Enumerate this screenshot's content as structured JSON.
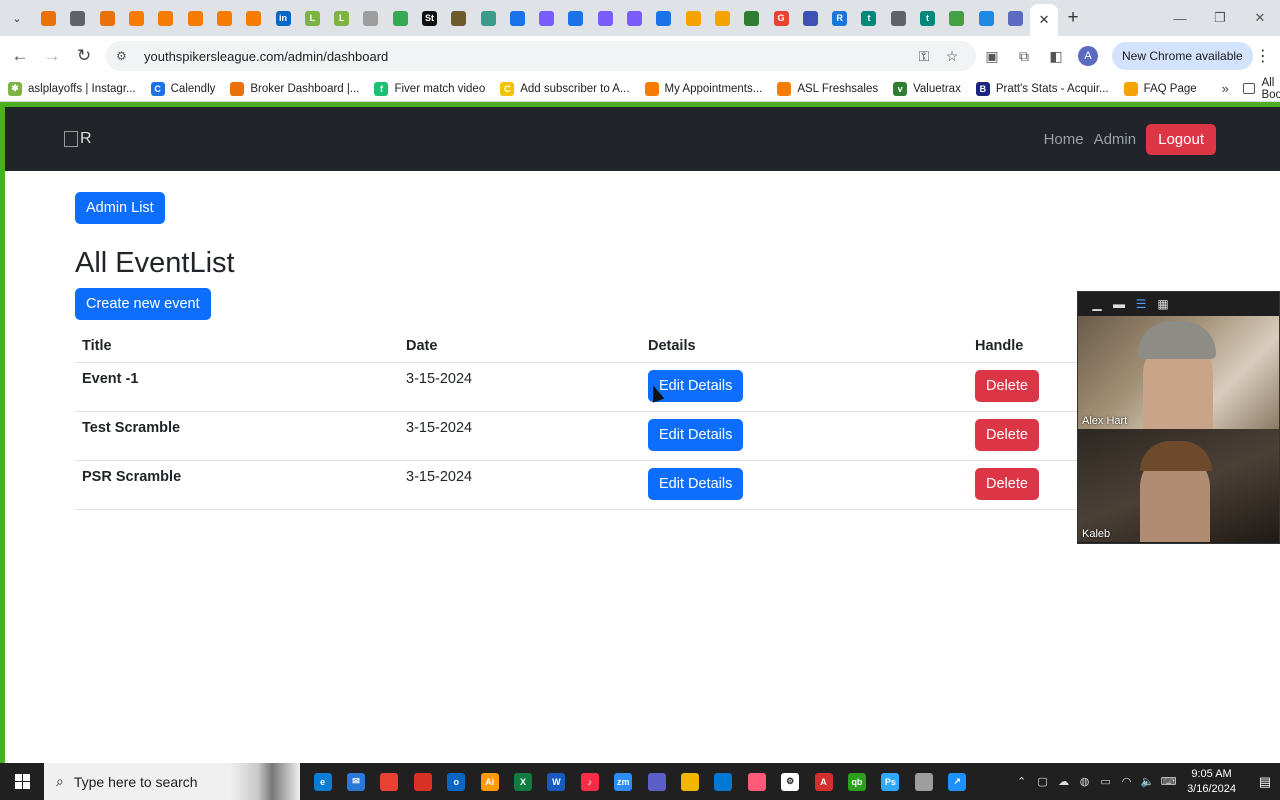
{
  "browser": {
    "tab_colors": [
      "#e8710a",
      "#5f6368",
      "#e8710a",
      "#f57c00",
      "#f57c00",
      "#f57c00",
      "#f57c00",
      "#f57c00",
      "#0a66c2",
      "#7cb342",
      "#7cb342",
      "#9e9e9e",
      "#34a853",
      "#111111",
      "#6d5b2e",
      "#3c9a8a",
      "#1a73e8",
      "#7b5cff",
      "#1a73e8",
      "#7b5cff",
      "#7b5cff",
      "#1a73e8",
      "#f4a300",
      "#f4a300",
      "#2e7d32",
      "#ea4335",
      "#3f51b5",
      "#1976d2",
      "#00897b",
      "#5f6368",
      "#00897b",
      "#43a047",
      "#1e88e5",
      "#5c6bc0"
    ],
    "tab_glyphs": [
      "",
      "",
      "",
      "",
      "",
      "",
      "",
      "",
      "in",
      "L",
      "L",
      "",
      "",
      "St",
      "",
      "",
      "",
      "",
      "",
      "",
      "",
      "",
      "",
      "",
      "",
      "G",
      "",
      "R",
      "t",
      "",
      "t",
      "",
      "",
      ""
    ],
    "url": "youthspikersleague.com/admin/dashboard",
    "update_label": "New Chrome available",
    "profile_initial": "A"
  },
  "bookmarks": [
    {
      "label": "aslplayoffs | Instagr...",
      "color": "#7cb342",
      "glyph": "✱"
    },
    {
      "label": "Calendly",
      "color": "#1a73e8",
      "glyph": "C"
    },
    {
      "label": "Broker Dashboard |...",
      "color": "#e8710a",
      "glyph": ""
    },
    {
      "label": "Fiver match video",
      "color": "#1dbf73",
      "glyph": "f"
    },
    {
      "label": "Add subscriber to A...",
      "color": "#f4c300",
      "glyph": "C"
    },
    {
      "label": "My Appointments...",
      "color": "#f57c00",
      "glyph": ""
    },
    {
      "label": "ASL Freshsales",
      "color": "#f57c00",
      "glyph": ""
    },
    {
      "label": "Valuetrax",
      "color": "#2e7d32",
      "glyph": "v"
    },
    {
      "label": "Pratt's Stats - Acquir...",
      "color": "#1a237e",
      "glyph": "B"
    },
    {
      "label": "FAQ Page",
      "color": "#f4a300",
      "glyph": ""
    }
  ],
  "bookmarks_all": "All Bookmarks",
  "site": {
    "logo_alt": "R",
    "nav": {
      "home": "Home",
      "admin": "Admin",
      "logout": "Logout"
    },
    "admin_list_btn": "Admin List",
    "heading": "All EventList",
    "create_btn": "Create new event",
    "columns": [
      "Title",
      "Date",
      "Details",
      "Handle"
    ],
    "events": [
      {
        "title": "Event -1",
        "date": "3-15-2024",
        "edit": "Edit Details",
        "delete": "Delete"
      },
      {
        "title": "Test Scramble",
        "date": "3-15-2024",
        "edit": "Edit Details",
        "delete": "Delete"
      },
      {
        "title": "PSR Scramble",
        "date": "3-15-2024",
        "edit": "Edit Details",
        "delete": "Delete"
      }
    ]
  },
  "call": {
    "participants": [
      "Alex Hart",
      "Kaleb"
    ]
  },
  "taskbar": {
    "search_placeholder": "Type here to search",
    "app_colors": [
      "#0a7cd4",
      "#2b78d9",
      "#e94235",
      "#d93025",
      "#0a66c2",
      "#ff9a00",
      "#107c41",
      "#185abd",
      "#fa2d48",
      "#2d8cff",
      "#5b5fc7",
      "#f2b600",
      "#0078d4",
      "#ff5a79",
      "#ffffff",
      "#d32f2f",
      "#2ca01c",
      "#31a8ff",
      "#9e9e9e",
      "#1e90ff"
    ],
    "app_glyphs": [
      "e",
      "✉",
      "",
      "",
      "o",
      "Ai",
      "X",
      "W",
      "♪",
      "zm",
      "",
      "",
      "",
      "",
      "⚙",
      "A",
      "qb",
      "Ps",
      "",
      "↗"
    ],
    "time": "9:05 AM",
    "date": "3/16/2024"
  }
}
